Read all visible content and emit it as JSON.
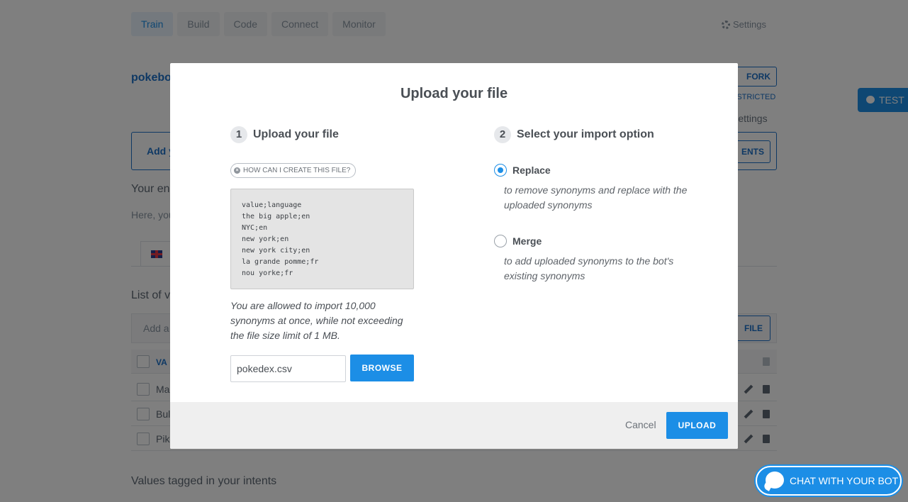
{
  "nav": {
    "tabs": [
      {
        "label": "Train"
      },
      {
        "label": "Build"
      },
      {
        "label": "Code"
      },
      {
        "label": "Connect"
      },
      {
        "label": "Monitor"
      }
    ],
    "settings_label": "Settings"
  },
  "background": {
    "bot_name": "pokebot",
    "fork_label": "FORK",
    "restricted_label": "ESTRICTED",
    "settings_label": "Settings",
    "test_label": "TEST",
    "add_label": "Add y",
    "add_right_label": "ENTS",
    "your_entity_heading": "Your en",
    "here_you_text": "Here, you",
    "list_heading": "List of v",
    "add_value_placeholder": "Add a",
    "file_button_label": "FILE",
    "table_header": "VA",
    "rows": [
      {
        "value": "Ma"
      },
      {
        "value": "Bul"
      },
      {
        "value": "Pik"
      }
    ],
    "values_tagged_heading": "Values tagged in your intents",
    "chat_button_label": "CHAT WITH YOUR BOT"
  },
  "modal": {
    "title": "Upload your file",
    "step1": {
      "number": "1",
      "title": "Upload your file"
    },
    "howto_label": "HOW CAN I CREATE THIS FILE?",
    "code_lines": [
      "value;language",
      "the big apple;en",
      "NYC;en",
      "new york;en",
      "new york city;en",
      "la grande pomme;fr",
      "nou yorke;fr"
    ],
    "allowed_text": "You are allowed to import 10,000 synonyms at once, while not exceeding the file size limit of 1 MB.",
    "file_input_value": "pokedex.csv",
    "browse_label": "BROWSE",
    "step2": {
      "number": "2",
      "title": "Select your import option"
    },
    "options": [
      {
        "label": "Replace",
        "description": "to remove synonyms and replace with the uploaded synonyms",
        "checked": true
      },
      {
        "label": "Merge",
        "description": "to add uploaded synonyms to the bot's existing synonyms",
        "checked": false
      }
    ],
    "cancel_label": "Cancel",
    "upload_label": "UPLOAD"
  },
  "colors": {
    "accent": "#1c8ee6",
    "overlay": "rgba(0,0,0,0.5)"
  }
}
